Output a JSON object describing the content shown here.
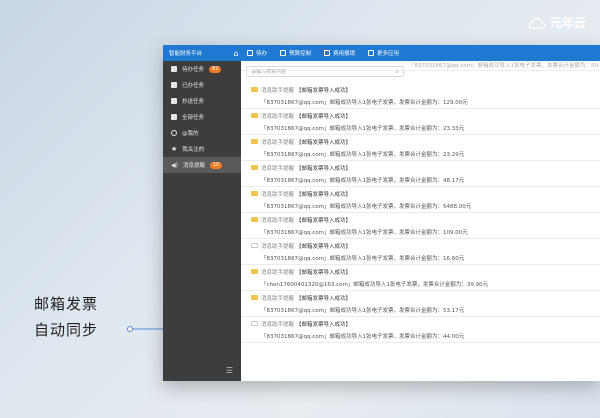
{
  "brand": {
    "name": "元年云"
  },
  "annotation": {
    "line1": "邮箱发票",
    "line2": "自动同步"
  },
  "topbar": {
    "title": "智能财务平台",
    "nav": [
      "待办",
      "预算控制",
      "费用报销",
      "更多应用"
    ]
  },
  "sidebar": {
    "items": [
      {
        "label": "待办任务",
        "badge": "62"
      },
      {
        "label": "已办任务",
        "badge": ""
      },
      {
        "label": "抄送任务",
        "badge": ""
      },
      {
        "label": "全部任务",
        "badge": ""
      },
      {
        "label": "@我的",
        "badge": ""
      },
      {
        "label": "我关注的",
        "badge": ""
      },
      {
        "label": "消息提醒",
        "badge": "10"
      }
    ]
  },
  "search": {
    "placeholder": "请输入搜索内容"
  },
  "messages": {
    "partial": "「837031867@qq.com」邮箱成功导入1张电子发票，发票合计金额为：504.00元",
    "items": [
      {
        "source": "消息助手提醒",
        "title": "【邮箱发票导入成功】",
        "body": "「837031867@qq.com」邮箱成功导入1张电子发票，发票合计金额为：129.00元",
        "read": false
      },
      {
        "source": "消息助手提醒",
        "title": "【邮箱发票导入成功】",
        "body": "「837031867@qq.com」邮箱成功导入1张电子发票，发票合计金额为：23.33元",
        "read": false
      },
      {
        "source": "消息助手提醒",
        "title": "【邮箱发票导入成功】",
        "body": "「837031867@qq.com」邮箱成功导入1张电子发票，发票合计金额为：23.29元",
        "read": false
      },
      {
        "source": "消息助手提醒",
        "title": "【邮箱发票导入成功】",
        "body": "「837031867@qq.com」邮箱成功导入1张电子发票，发票合计金额为：48.17元",
        "read": false
      },
      {
        "source": "消息助手提醒",
        "title": "【邮箱发票导入成功】",
        "body": "「837031867@qq.com」邮箱成功导入1张电子发票，发票合计金额为：5488.00元",
        "read": false
      },
      {
        "source": "消息助手提醒",
        "title": "【邮箱发票导入成功】",
        "body": "「837031867@qq.com」邮箱成功导入1张电子发票，发票合计金额为：109.00元",
        "read": false
      },
      {
        "source": "消息助手提醒",
        "title": "【邮箱发票导入成功】",
        "body": "「837031867@qq.com」邮箱成功导入1张电子发票，发票合计金额为：16.60元",
        "read": true
      },
      {
        "source": "消息助手提醒",
        "title": "【邮箱发票导入成功】",
        "body": "「chen17600401320@163.com」邮箱成功导入1张电子发票，发票合计金额为：39.90元",
        "read": false
      },
      {
        "source": "消息助手提醒",
        "title": "【邮箱发票导入成功】",
        "body": "「837031867@qq.com」邮箱成功导入1张电子发票，发票合计金额为：53.17元",
        "read": false
      },
      {
        "source": "消息助手提醒",
        "title": "【邮箱发票导入成功】",
        "body": "「837031867@qq.com」邮箱成功导入1张电子发票，发票合计金额为：44.00元",
        "read": true
      }
    ]
  },
  "colors": {
    "topbar": "#1f78d1",
    "sidebar": "#3d3d3d",
    "badge": "#f07b22",
    "envelope": "#f2c24f"
  }
}
